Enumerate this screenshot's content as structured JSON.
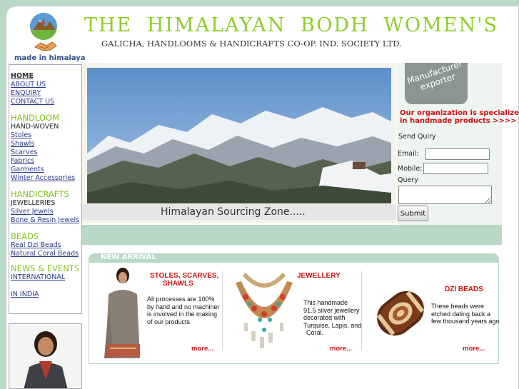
{
  "header": {
    "title": "THE HIMALAYAN BODH WOMEN'S",
    "subtitle": "GALICHA, HANDLOOMS & HANDICRAFTS CO-OP. IND. SOCIETY LTD.",
    "made_in": "made in himalaya"
  },
  "nav": {
    "home": "HOME",
    "about": "ABOUT US",
    "enquiry": "ENQUIRY",
    "contact": "CONTACT US",
    "handloom_head": "HANDLOOM",
    "hand_woven": "HAND-WOVEN",
    "stoles": "Stoles",
    "shawls": "Shawls",
    "scarves": "Scarves",
    "fabrics": "Fabrics",
    "garments": "Garments",
    "winter_accessories": "Winter Accessories",
    "handicrafts_head": "HANDICRAFTS",
    "jewelleries": "JEWELLERIES",
    "silver_jewels": "Silver Jewels",
    "bone_resin": "Bone & Resin Jewels",
    "beads_head": "BEADS",
    "real_dzi": "Real Dzi Beads",
    "natural_coral": "Natural Coral Beads",
    "news_head": "NEWS & EVENTS",
    "international": "INTERNATIONAL",
    "in_india": "IN INDIA"
  },
  "hero": {
    "caption": "Himalayan  Sourcing Zone....."
  },
  "side": {
    "badge": "Manufacturer exporter",
    "specialize_1": "Our organization is specialize",
    "specialize_2": "in handmade products >>>>",
    "send_quiry": "Send Quiry",
    "email_label": "Email:",
    "mobile_label": "Mobile:",
    "query_label": "Query",
    "submit": "Submit"
  },
  "new_arrival": {
    "title": "NEW ARRIVAL",
    "products": [
      {
        "title_1": "STOLES, SCARVES,",
        "title_2": "SHAWLS",
        "desc": [
          "All processes are 100%",
          "by hand and no machiner",
          "is involved in the making",
          "of our products"
        ],
        "more": "more..."
      },
      {
        "title_1": "JEWELLERY",
        "title_2": "",
        "desc": [
          "This handmade",
          "91.5 silver jewellery",
          " decorated with",
          "Turquise, Lapis, and",
          "Coral."
        ],
        "more": "more..."
      },
      {
        "title_1": "DZI BEADS",
        "title_2": "",
        "desc": [
          "These beads were",
          "etched dating back a",
          "few thousand years ago"
        ],
        "more": "more..."
      }
    ]
  }
}
